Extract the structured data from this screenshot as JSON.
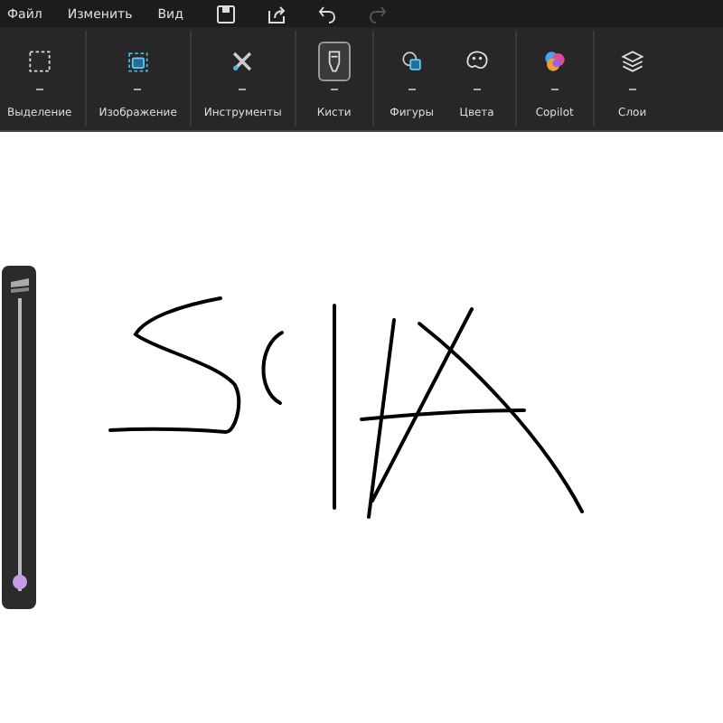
{
  "menu": [
    {
      "label": "Файл"
    },
    {
      "label": "Изменить"
    },
    {
      "label": "Вид"
    }
  ],
  "quick_actions": [
    {
      "kind": "save",
      "disabled": false
    },
    {
      "kind": "share",
      "disabled": false
    },
    {
      "kind": "undo",
      "disabled": false
    },
    {
      "kind": "redo",
      "disabled": true
    }
  ],
  "toolbar": [
    {
      "kind": "selection",
      "label": "Выделение",
      "selected": false
    },
    {
      "kind": "image",
      "label": "Изображение",
      "selected": false
    },
    {
      "kind": "tools",
      "label": "Инструменты",
      "selected": false
    },
    {
      "kind": "brushes",
      "label": "Кисти",
      "selected": true
    },
    {
      "kind": "shapes",
      "label": "Фигуры",
      "selected": false
    },
    {
      "kind": "colors",
      "label": "Цвета",
      "selected": false
    },
    {
      "kind": "copilot",
      "label": "Copilot",
      "selected": false
    },
    {
      "kind": "layers",
      "label": "Слои",
      "selected": false
    }
  ],
  "brush_size": {
    "level": 0.02
  }
}
